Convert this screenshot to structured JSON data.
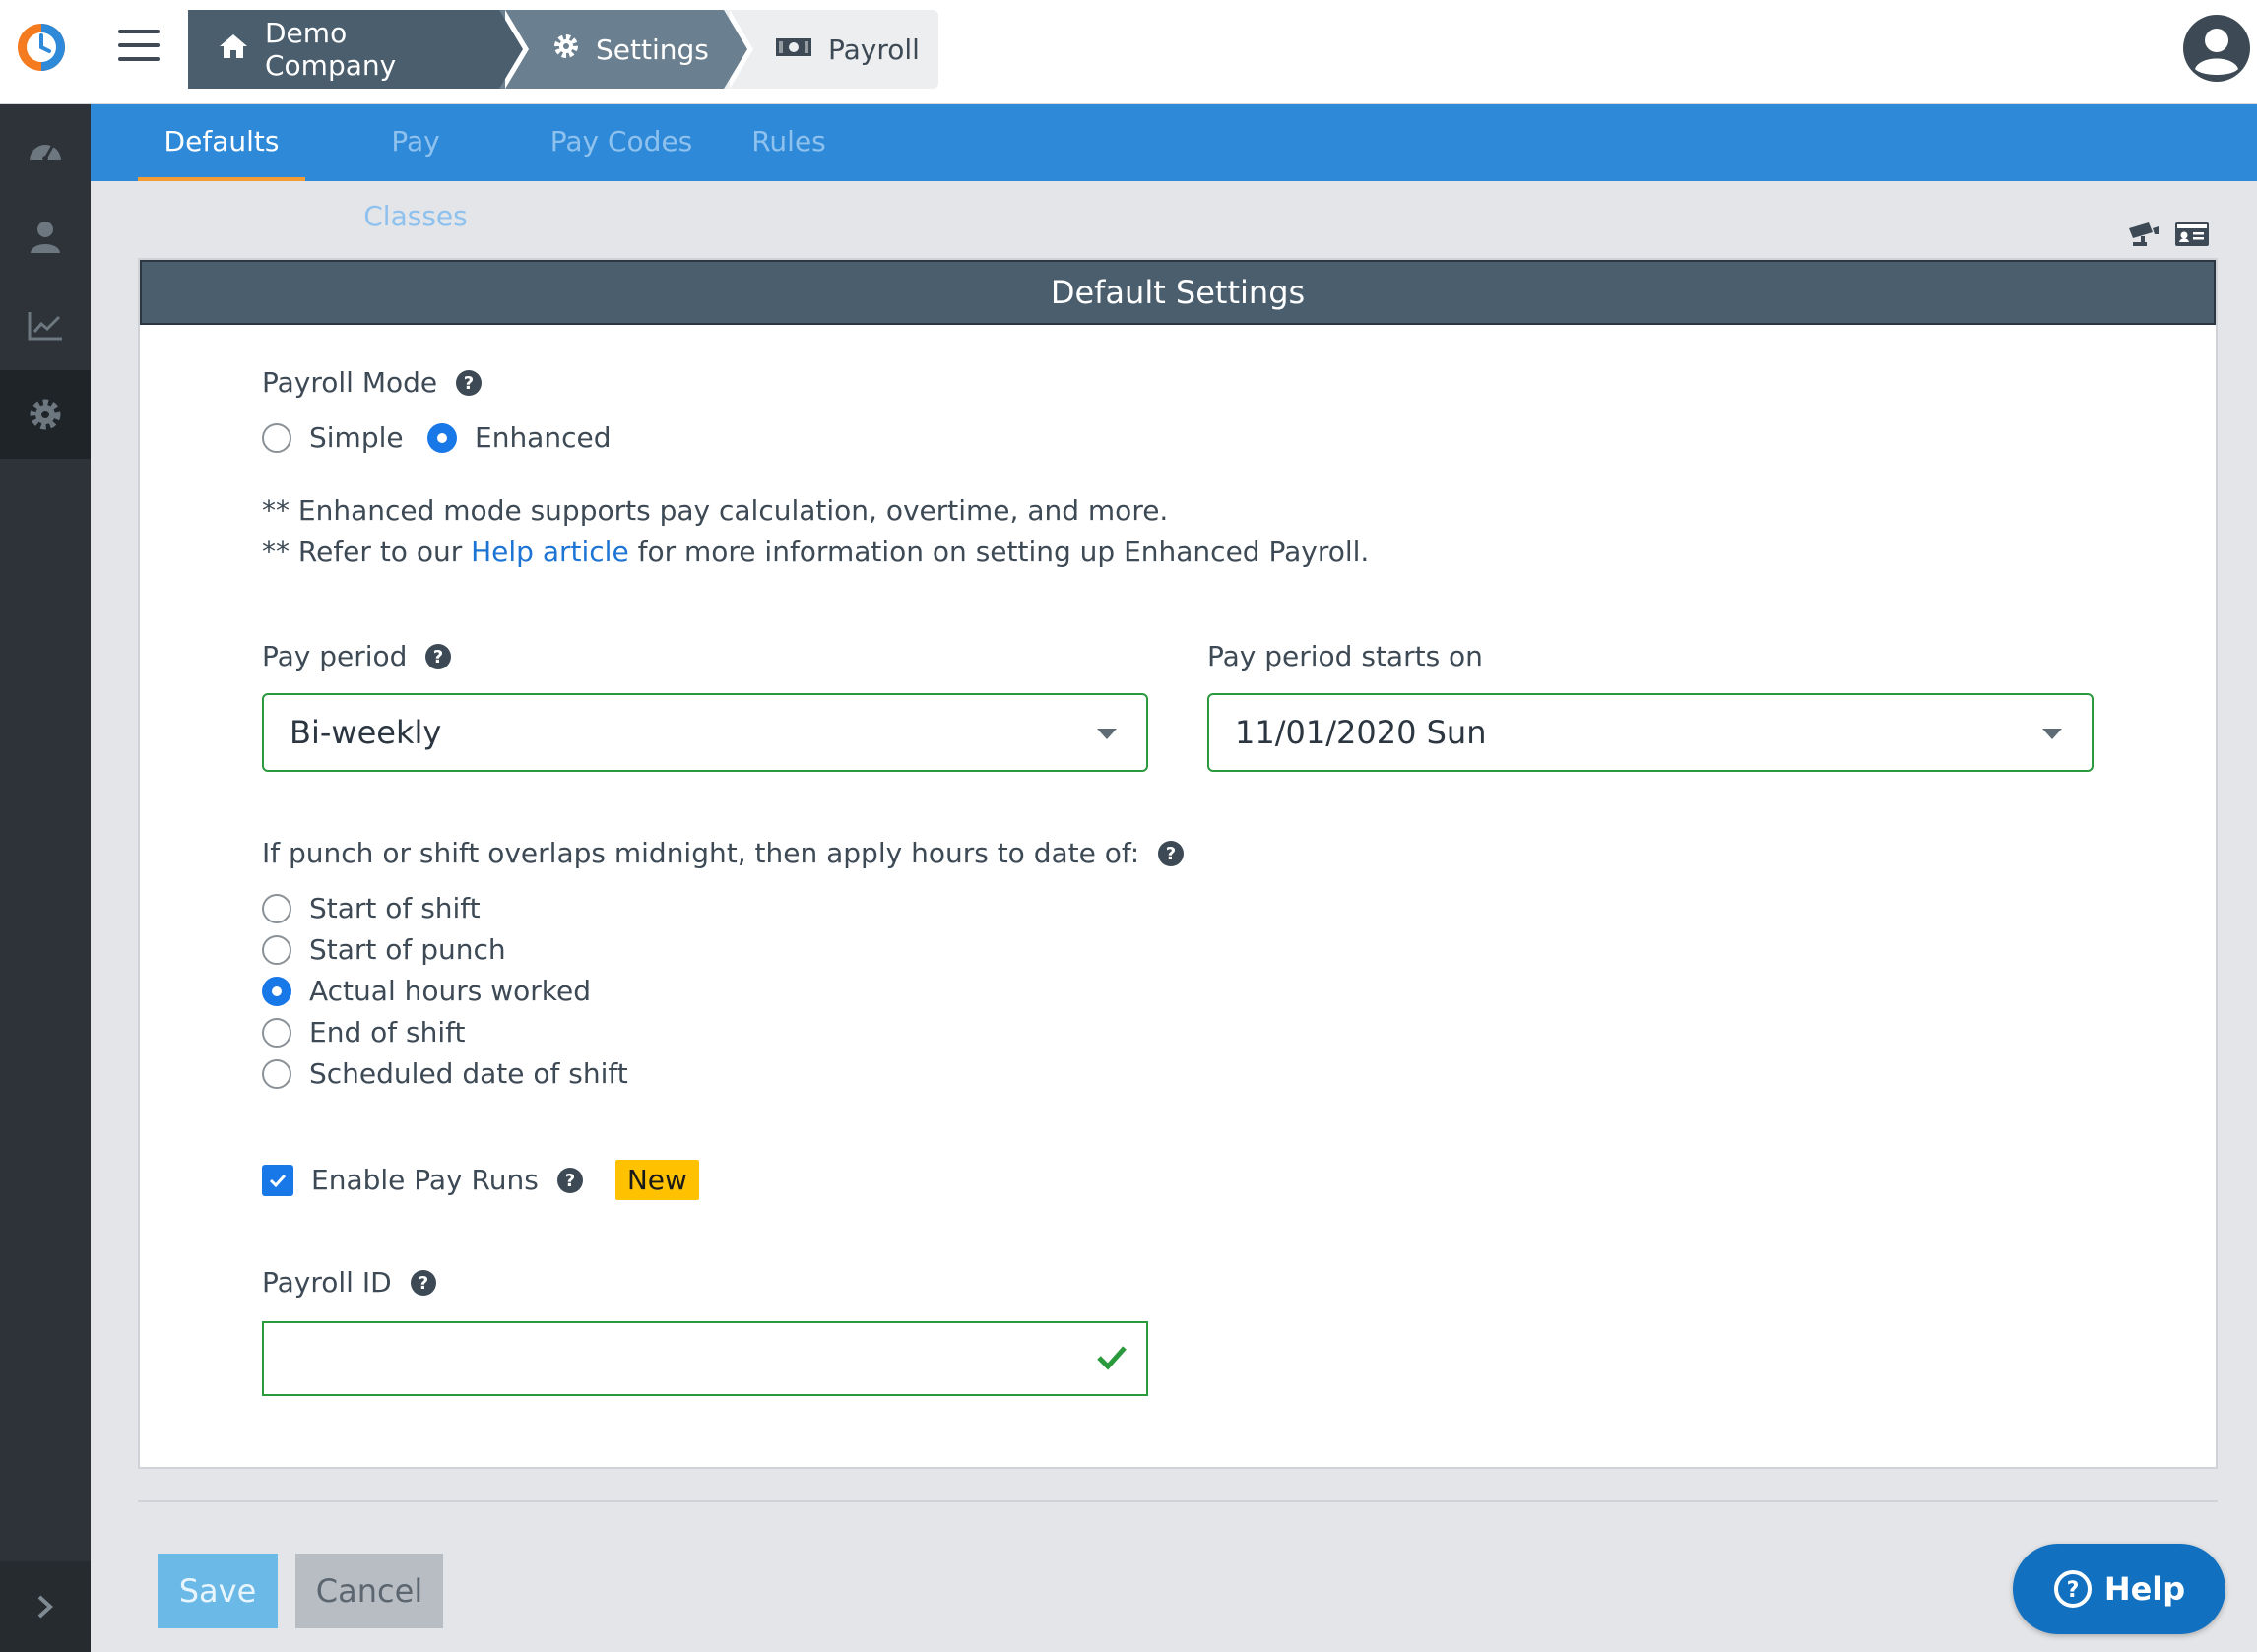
{
  "header": {
    "breadcrumb": [
      {
        "label": "Demo Company",
        "icon": "home-icon"
      },
      {
        "label": "Settings",
        "icon": "gear-icon"
      },
      {
        "label": "Payroll",
        "icon": "money-icon"
      }
    ]
  },
  "tabs": [
    {
      "label": "Defaults",
      "active": true
    },
    {
      "label": "Pay Classes",
      "active": false
    },
    {
      "label": "Pay Codes",
      "active": false
    },
    {
      "label": "Rules",
      "active": false
    }
  ],
  "panel": {
    "title": "Default Settings",
    "payroll_mode": {
      "label": "Payroll Mode",
      "options": [
        "Simple",
        "Enhanced"
      ],
      "selected": "Enhanced"
    },
    "notes": {
      "line1": "** Enhanced mode supports pay calculation, overtime, and more.",
      "line2_prefix": "** Refer to our ",
      "line2_link": "Help article",
      "line2_suffix": " for more information on setting up Enhanced Payroll."
    },
    "pay_period": {
      "label": "Pay period",
      "value": "Bi-weekly"
    },
    "pay_period_start": {
      "label": "Pay period starts on",
      "value": "11/01/2020 Sun"
    },
    "midnight": {
      "label": "If punch or shift overlaps midnight, then apply hours to date of:",
      "options": [
        "Start of shift",
        "Start of punch",
        "Actual hours worked",
        "End of shift",
        "Scheduled date of shift"
      ],
      "selected": "Actual hours worked"
    },
    "pay_runs": {
      "label": "Enable Pay Runs",
      "checked": true,
      "badge": "New"
    },
    "payroll_id": {
      "label": "Payroll ID",
      "value": ""
    }
  },
  "actions": {
    "save": "Save",
    "cancel": "Cancel",
    "help": "Help"
  },
  "colors": {
    "accent": "#2e8ad8",
    "tab_indicator": "#f39c34",
    "valid": "#2a9a3c",
    "badge": "#ffc100"
  }
}
